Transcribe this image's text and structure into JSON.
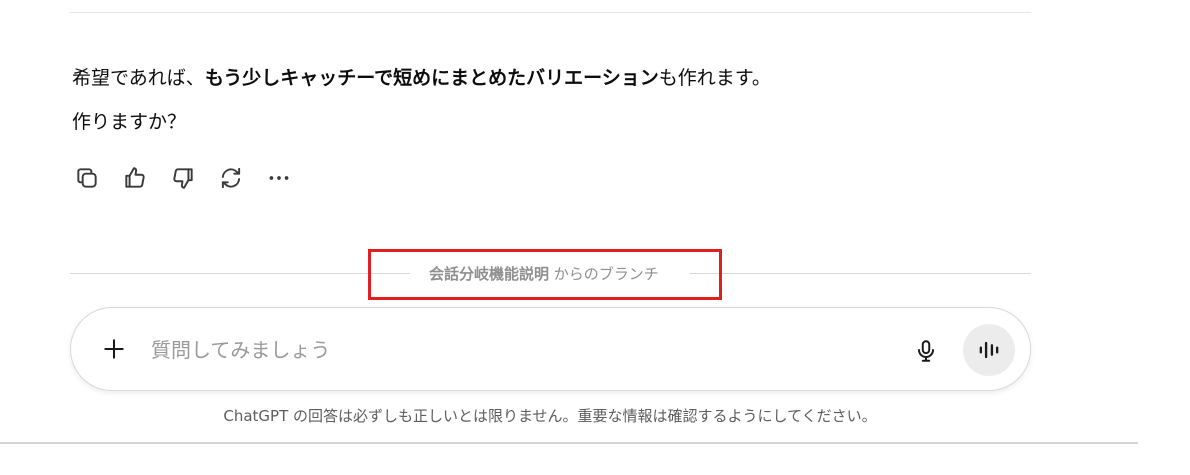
{
  "message": {
    "line1_prefix": "希望であれば、",
    "line1_bold": "もう少しキャッチーで短めにまとめたバリエーション",
    "line1_suffix": "も作れます。",
    "line2": "作りますか？"
  },
  "actions": [
    {
      "icon": "copy-icon"
    },
    {
      "icon": "thumbs-up-icon"
    },
    {
      "icon": "thumbs-down-icon"
    },
    {
      "icon": "regenerate-icon"
    },
    {
      "icon": "more-icon"
    }
  ],
  "branch": {
    "source_name": "会話分岐機能説明",
    "suffix": " からのブランチ",
    "highlight_color": "#e02020"
  },
  "composer": {
    "placeholder": "質問してみましょう",
    "value": ""
  },
  "footer": {
    "disclaimer": "ChatGPT の回答は必ずしも正しいとは限りません。重要な情報は確認するようにしてください。"
  }
}
